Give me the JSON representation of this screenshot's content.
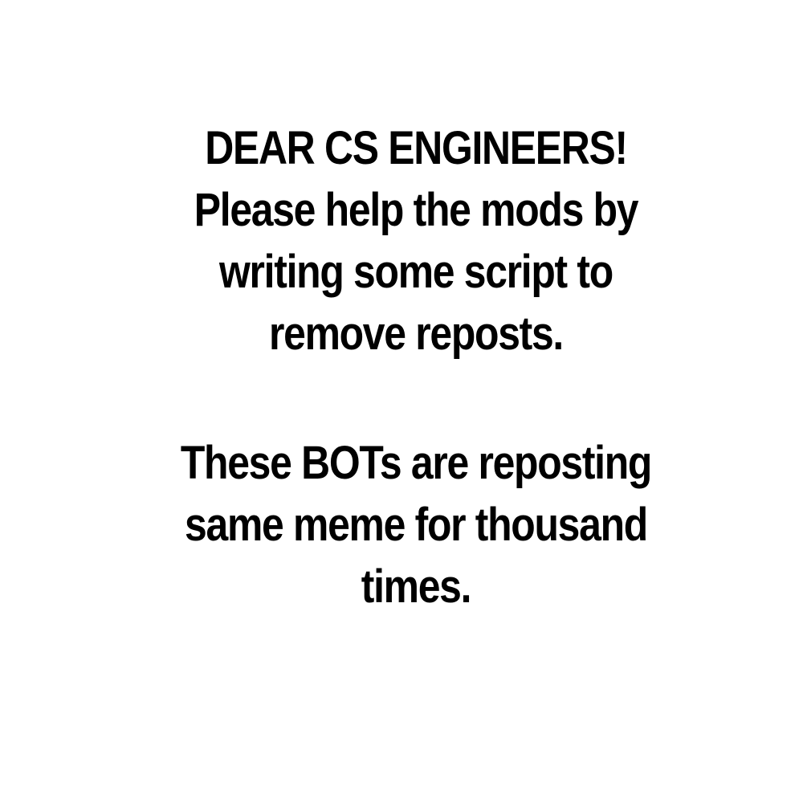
{
  "message": {
    "first_block": [
      "DEAR CS ENGINEERS!",
      "Please help the mods by",
      "writing some script to",
      "remove reposts."
    ],
    "second_block": [
      "These BOTs are reposting",
      "same meme for thousand",
      "times."
    ]
  },
  "colors": {
    "background": "#ffffff",
    "text": "#000000"
  }
}
